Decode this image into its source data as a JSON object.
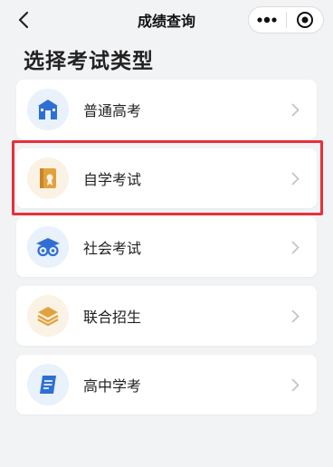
{
  "nav": {
    "title": "成绩查询",
    "back_icon": "chevron-left-icon",
    "more_icon": "more-dots-icon",
    "close_icon": "target-circle-icon"
  },
  "page": {
    "title": "选择考试类型"
  },
  "exam_types": [
    {
      "label": "普通高考",
      "icon": "school-building-icon",
      "bg": "#e9f1fb",
      "color": "#2f6fd3"
    },
    {
      "label": "自学考试",
      "icon": "book-badge-icon",
      "bg": "#fbf2e6",
      "color": "#e2a23b"
    },
    {
      "label": "社会考试",
      "icon": "graduation-cap-icon",
      "bg": "#e9f1fb",
      "color": "#2f6fd3"
    },
    {
      "label": "联合招生",
      "icon": "layers-stack-icon",
      "bg": "#fbf2e6",
      "color": "#e2a23b"
    },
    {
      "label": "高中学考",
      "icon": "scroll-document-icon",
      "bg": "#e9f1fb",
      "color": "#2f6fd3"
    }
  ],
  "colors": {
    "highlight_border": "#e8303a",
    "chevron": "#c4c4c4"
  }
}
